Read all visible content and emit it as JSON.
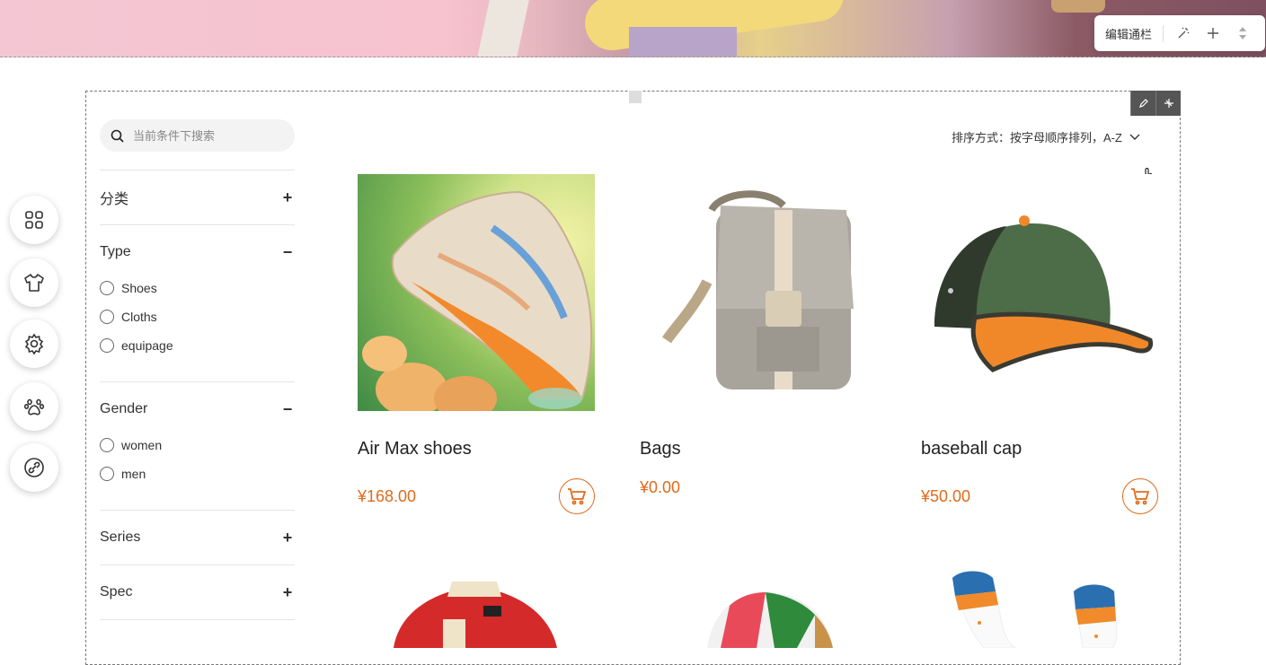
{
  "nav_toolbar": {
    "edit_label": "编辑通栏"
  },
  "search": {
    "placeholder": "当前条件下搜索"
  },
  "filters": [
    {
      "title": "分类",
      "sign": "+",
      "options": []
    },
    {
      "title": "Type",
      "sign": "−",
      "options": [
        "Shoes",
        "Cloths",
        "equipage"
      ]
    },
    {
      "title": "Gender",
      "sign": "−",
      "options": [
        "women",
        "men"
      ]
    },
    {
      "title": "Series",
      "sign": "+",
      "options": []
    },
    {
      "title": "Spec",
      "sign": "+",
      "options": []
    }
  ],
  "sort": {
    "label": "排序方式：按字母顺序排列，A-Z"
  },
  "products": [
    {
      "name": "Air Max shoes",
      "price": "¥168.00"
    },
    {
      "name": "Bags",
      "price": "¥0.00"
    },
    {
      "name": "baseball cap",
      "price": "¥50.00"
    }
  ],
  "sidebar_icons": [
    "grid-icon",
    "tshirt-icon",
    "gear-icon",
    "paw-icon",
    "link-icon"
  ],
  "colors": {
    "accent": "#e06a1b"
  }
}
